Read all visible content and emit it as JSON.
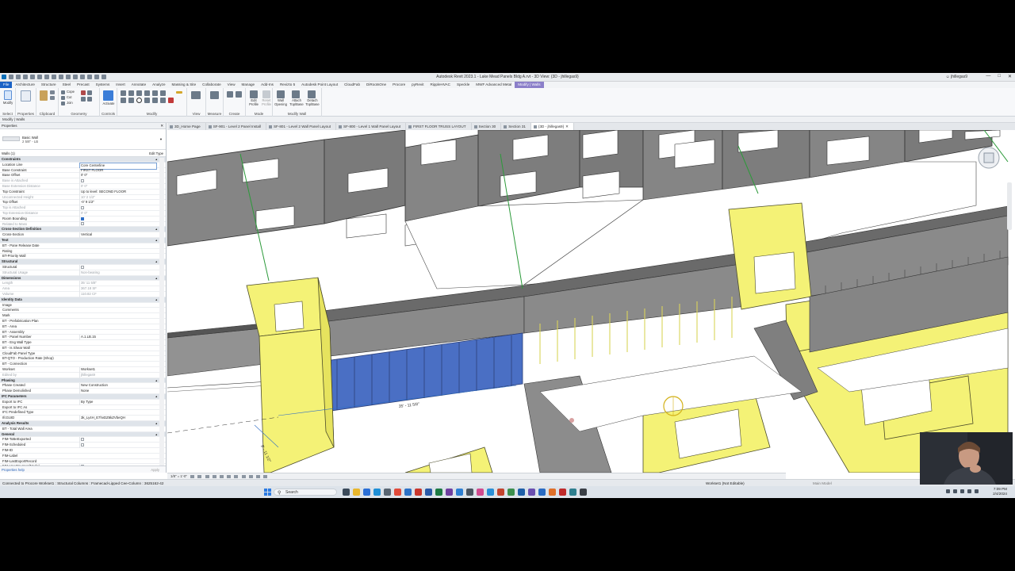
{
  "app": {
    "title": "Autodesk Revit 2023.1 - Lake Mead Panels Bldg A.rvt - 3D View: {3D - jhillegas9}",
    "user": "jhillegas9"
  },
  "ribbon_tabs": [
    "File",
    "Architecture",
    "Structure",
    "Steel",
    "Precast",
    "Systems",
    "Insert",
    "Annotate",
    "Analyze",
    "Massing & Site",
    "Collaborate",
    "View",
    "Manage",
    "Add-Ins",
    "Revizto 5",
    "Autodesk Point Layout",
    "CloudFab",
    "DiRootsOne",
    "Procore",
    "pyRevit",
    "RippleHVAC",
    "Speckle",
    "MWF Advanced Metal",
    "Modify | Walls"
  ],
  "ribbon_panels": {
    "select": "Select",
    "properties": "Properties",
    "clipboard": "Clipboard",
    "geometry": "Geometry",
    "controls": "Controls",
    "modify": "Modify",
    "view": "View",
    "measure": "Measure",
    "create": "Create",
    "mode": "Mode",
    "modify_wall": "Modify Wall"
  },
  "ribbon_buttons": {
    "modify": "Modify",
    "activate": "Activate",
    "edit_profile": "Edit Profile",
    "reset_profile": "Reset Profile",
    "wall_opening": "Wall Opening",
    "attach": "Attach Top/Base",
    "detach": "Detach Top/Base",
    "cope": "Cope",
    "cut": "Cut",
    "join": "Join"
  },
  "context_bar": "Modify | Walls",
  "properties": {
    "header": "Properties",
    "type_name": "Basic Wall",
    "type_sub": "2 5/8\" - LB",
    "instance_filter": "Walls (1)",
    "edit_type": "Edit Type",
    "rows": [
      {
        "g": true,
        "n": "Constraints"
      },
      {
        "n": "Location Line",
        "v": "Core Centerline",
        "sel": true
      },
      {
        "n": "Base Constraint",
        "v": "FIRST FLOOR"
      },
      {
        "n": "Base Offset",
        "v": "0' 0\""
      },
      {
        "n": "Base is Attached",
        "v": "",
        "grey": true,
        "chk": false
      },
      {
        "n": "Base Extension Distance",
        "v": "0' 0\"",
        "grey": true
      },
      {
        "n": "Top Constraint",
        "v": "Up to level: SECOND FLOOR"
      },
      {
        "n": "Unconnected Height",
        "v": "10' 2 1/2\"",
        "grey": true
      },
      {
        "n": "Top Offset",
        "v": "-0' 9 1/2\""
      },
      {
        "n": "Top is Attached",
        "v": "",
        "grey": true,
        "chk": false
      },
      {
        "n": "Top Extension Distance",
        "v": "0' 0\"",
        "grey": true
      },
      {
        "n": "Room Bounding",
        "v": "",
        "chk": true
      },
      {
        "n": "Related to Mass",
        "v": "",
        "grey": true,
        "chk": false
      },
      {
        "g": true,
        "n": "Cross-Section Definition"
      },
      {
        "n": "Cross-Section",
        "v": "Vertical"
      },
      {
        "g": true,
        "n": "Text"
      },
      {
        "n": "BT - Pane Release Date",
        "v": ""
      },
      {
        "n": "Rating",
        "v": ""
      },
      {
        "n": "BT-Priority Wall",
        "v": ""
      },
      {
        "g": true,
        "n": "Structural"
      },
      {
        "n": "Structural",
        "v": "",
        "chk": false
      },
      {
        "n": "Structural Usage",
        "v": "Non-bearing",
        "grey": true
      },
      {
        "g": true,
        "n": "Dimensions"
      },
      {
        "n": "Length",
        "v": "35' 11 5/8\"",
        "grey": true
      },
      {
        "n": "Area",
        "v": "367.18 SF",
        "grey": true
      },
      {
        "n": "Volume",
        "v": "110.82 CF",
        "grey": true
      },
      {
        "g": true,
        "n": "Identity Data"
      },
      {
        "n": "Image",
        "v": ""
      },
      {
        "n": "Comments",
        "v": ""
      },
      {
        "n": "Mark",
        "v": ""
      },
      {
        "n": "BT - Prefabrication Plan",
        "v": ""
      },
      {
        "n": "BT - Area",
        "v": ""
      },
      {
        "n": "BT - Assembly",
        "v": ""
      },
      {
        "n": "BT - Panel Number",
        "v": "A.1.LB.15"
      },
      {
        "n": "BT - Eng Wall Type",
        "v": ""
      },
      {
        "n": "BT - Is Shear Wall",
        "v": ""
      },
      {
        "n": "CloudFab Panel Type",
        "v": ""
      },
      {
        "n": "BT-QTO - Production Rate (Shop)",
        "v": ""
      },
      {
        "n": "BT - Connection",
        "v": ""
      },
      {
        "n": "Workset",
        "v": "Workset1"
      },
      {
        "n": "Edited by",
        "v": "jhillegas9",
        "grey": true
      },
      {
        "g": true,
        "n": "Phasing"
      },
      {
        "n": "Phase Created",
        "v": "New Construction"
      },
      {
        "n": "Phase Demolished",
        "v": "None"
      },
      {
        "g": true,
        "n": "IFC Parameters"
      },
      {
        "n": "Export to IFC",
        "v": "By Type"
      },
      {
        "n": "Export to IFC As",
        "v": ""
      },
      {
        "n": "IFC Predefined Type",
        "v": ""
      },
      {
        "n": "IfcGUID",
        "v": "3k_Ly4H_E7hvDZ6kZVbeQH"
      },
      {
        "g": true,
        "n": "Analysis Results"
      },
      {
        "n": "BT - Total Wall Area",
        "v": ""
      },
      {
        "g": true,
        "n": "General"
      },
      {
        "n": "FIM-ToBeExported",
        "v": "",
        "chk": false
      },
      {
        "n": "FIM-Scheduled",
        "v": "",
        "chk": false
      },
      {
        "n": "FIM-ID",
        "v": ""
      },
      {
        "n": "FIM-Label",
        "v": ""
      },
      {
        "n": "FIM-LastExportRecord",
        "v": ""
      },
      {
        "n": "FIM-UseStructuralModel",
        "v": "",
        "chk": false
      }
    ],
    "help": "Properties help",
    "apply": "Apply"
  },
  "view_tabs": [
    {
      "label": "3D_Home Page",
      "active": false
    },
    {
      "label": "SF-901 - Level 2 Panel Install",
      "active": false
    },
    {
      "label": "SF-801 - Level 2 Wall Panel Layout",
      "active": false
    },
    {
      "label": "SF-800 - Level 1 Wall Panel Layout",
      "active": false
    },
    {
      "label": "FIRST FLOOR TRUSS LAYOUT",
      "active": false
    },
    {
      "label": "Section 30",
      "active": false
    },
    {
      "label": "Section 31",
      "active": false
    },
    {
      "label": "{3D - jhillegas9}",
      "active": true
    }
  ],
  "viewport": {
    "dimension_1": "35' - 11 5/8\"",
    "dimension_2": "8' - 11 1/2\""
  },
  "view_control": {
    "scale": "1/8\" = 1'-0\""
  },
  "status": {
    "left": "Connected to Procore     Workset1 : Structural Columns : Framecad-Lipped Cee-Column : 3625162-42",
    "workset": "Workset1 (Not Editable)",
    "main_model": "Main Model"
  },
  "taskbar": {
    "search": "Search",
    "time": "7:09 PM",
    "date": "2/4/2024"
  },
  "colors": {
    "wall_grey": "#858585",
    "wall_top": "#6a6a6a",
    "selected_yellow": "#f4f276",
    "selected_blue": "#4a6fc4",
    "ribbon_accent": "#8b7fc9",
    "file_tab": "#1a62c6"
  }
}
